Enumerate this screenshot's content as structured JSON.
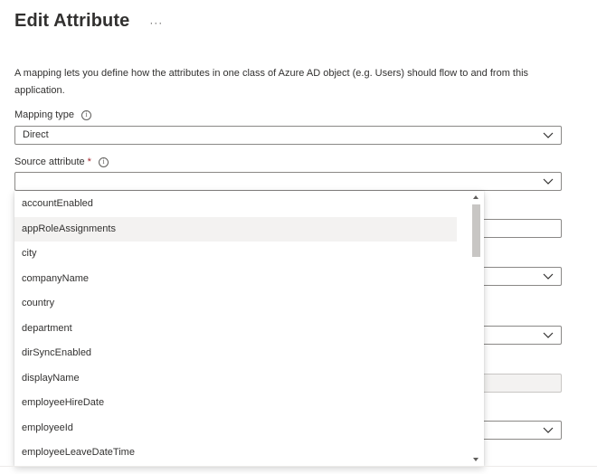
{
  "header": {
    "title": "Edit Attribute",
    "more_label": "···"
  },
  "description": "A mapping lets you define how the attributes in one class of Azure AD object (e.g. Users) should flow to and from this application.",
  "mapping_type": {
    "label": "Mapping type",
    "info_icon": "info-icon",
    "value": "Direct"
  },
  "source_attribute": {
    "label": "Source attribute",
    "required_marker": "*",
    "info_icon": "info-icon",
    "value": "",
    "options": [
      "accountEnabled",
      "appRoleAssignments",
      "city",
      "companyName",
      "country",
      "department",
      "dirSyncEnabled",
      "displayName",
      "employeeHireDate",
      "employeeId",
      "employeeLeaveDateTime"
    ],
    "hovered_option": "appRoleAssignments"
  },
  "icons": {
    "chevron": "chevron-down-icon",
    "info": "i"
  },
  "colors": {
    "text": "#323130",
    "border": "#8a8886",
    "hover": "#f3f2f1",
    "required": "#a4262c",
    "disabled_bg": "#f3f2f1",
    "scroll_thumb": "#c8c6c4"
  }
}
